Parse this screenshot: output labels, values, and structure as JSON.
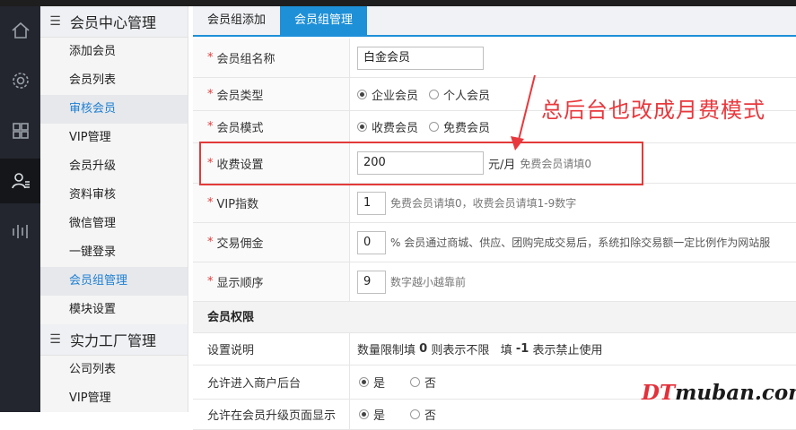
{
  "sidebar": {
    "group1": "会员中心管理",
    "items1": [
      "添加会员",
      "会员列表",
      "审核会员",
      "VIP管理",
      "会员升级",
      "资料审核",
      "微信管理",
      "一键登录",
      "会员组管理",
      "模块设置"
    ],
    "group2": "实力工厂管理",
    "items2": [
      "公司列表",
      "VIP管理"
    ]
  },
  "tabs": [
    "会员组添加",
    "会员组管理"
  ],
  "form": {
    "group_name_label": "会员组名称",
    "group_name_value": "白金会员",
    "type_label": "会员类型",
    "type_options": [
      "企业会员",
      "个人会员"
    ],
    "mode_label": "会员模式",
    "mode_options": [
      "收费会员",
      "免费会员"
    ],
    "fee_label": "收费设置",
    "fee_value": "200",
    "fee_unit": "元/月",
    "fee_hint": "免费会员请填0",
    "vip_label": "VIP指数",
    "vip_value": "1",
    "vip_hint": "免费会员请填0，收费会员请填1-9数字",
    "commission_label": "交易佣金",
    "commission_value": "0",
    "commission_hint": "% 会员通过商城、供应、团购完成交易后，系统扣除交易额一定比例作为网站服",
    "order_label": "显示顺序",
    "order_value": "9",
    "order_hint": "数字越小越靠前"
  },
  "perm": {
    "section": "会员权限",
    "desc_label": "设置说明",
    "desc_pre": "数量限制填 ",
    "desc_zero": "0",
    "desc_mid": " 则表示不限   填 ",
    "desc_neg": "-1",
    "desc_post": " 表示禁止使用",
    "backend_label": "允许进入商户后台",
    "yes": "是",
    "no": "否",
    "upgrade_label": "允许在会员升级页面显示"
  },
  "annotation": "总后台也改成月费模式",
  "watermark": {
    "dt": "DT",
    "rest": "muban.com"
  },
  "colors": {
    "accent": "#1e90d8",
    "annotation": "#e8383d"
  }
}
